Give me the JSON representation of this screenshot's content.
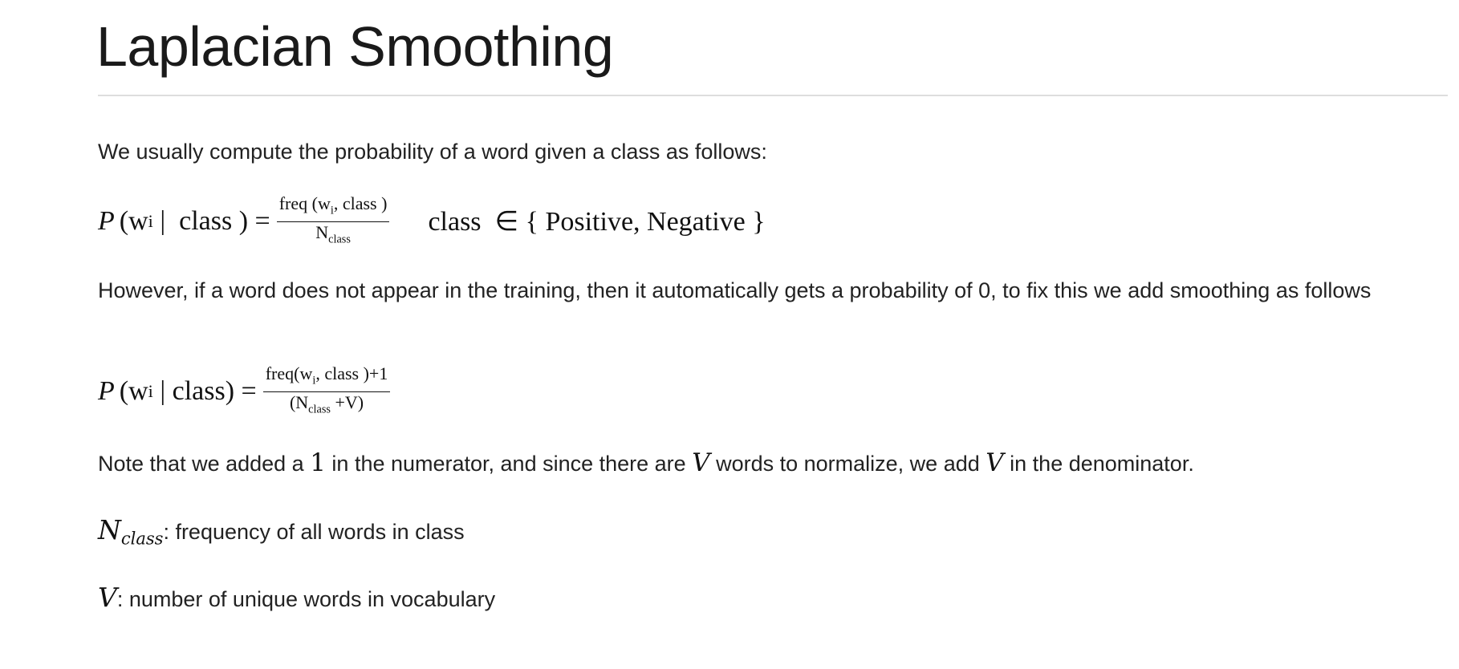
{
  "title": "Laplacian Smoothing",
  "intro": "We usually compute the probability of a word given a class as follows:",
  "formula1": {
    "lhs_P": "P",
    "lhs_args": "(w",
    "lhs_sub": "i",
    "lhs_rest": " |  class ) =",
    "num": "freq (w",
    "num_sub": "i",
    "num_rest": ", class )",
    "den": "N",
    "den_sub": "class",
    "set_text": "class  ∈ { Positive, Negative }"
  },
  "however": "However, if a word does not appear in the training, then it automatically gets a probability of 0, to fix this we add smoothing as follows",
  "formula2": {
    "lhs_P": "P",
    "lhs_args": "(w",
    "lhs_sub": "i",
    "lhs_rest": " | class) =",
    "num": "freq(w",
    "num_sub": "i",
    "num_rest": ", class )+1",
    "den": "(N",
    "den_sub": "class",
    "den_rest": " +V)"
  },
  "note": {
    "a": "Note that we added a ",
    "one": "1",
    "b": " in the numerator, and since there are ",
    "v1": "V",
    "c": " words to normalize, we add ",
    "v2": "V",
    "d": " in the denominator."
  },
  "def_n": {
    "sym": "N",
    "sub": "class",
    "text": ": frequency of all words in class"
  },
  "def_v": {
    "sym": "V",
    "text": ": number of unique words in vocabulary"
  }
}
